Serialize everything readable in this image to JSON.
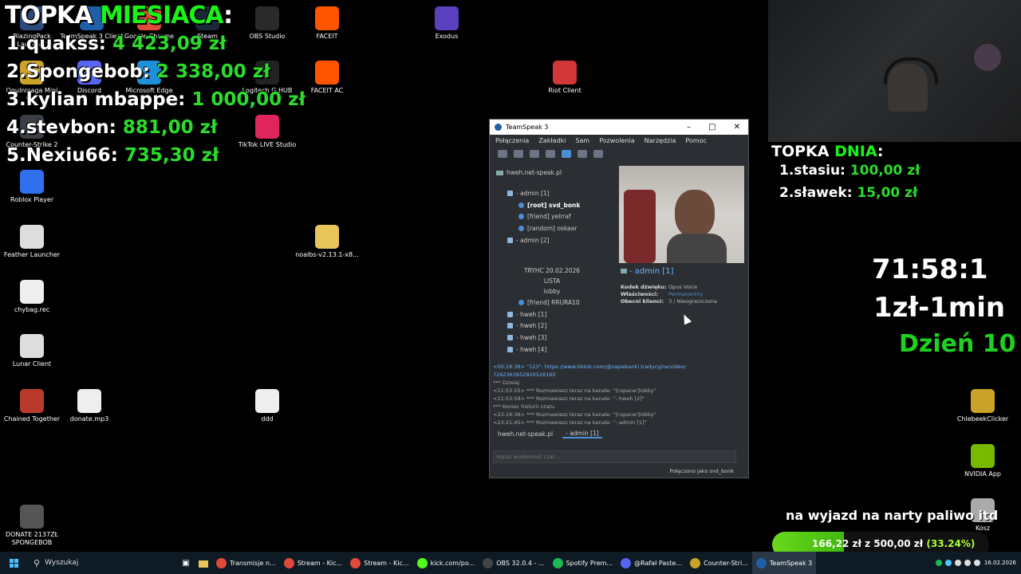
{
  "desktop_icons": [
    {
      "label": "BlazingPack Launcher",
      "color": "#2b4a7a"
    },
    {
      "label": "TeamSpeak 3 Client",
      "color": "#1f5fa8"
    },
    {
      "label": "Google Chrome",
      "color": "#e04a3a"
    },
    {
      "label": "Steam",
      "color": "#1b2838"
    },
    {
      "label": "OBS Studio",
      "color": "#2a2a2a"
    },
    {
      "label": "FACEIT",
      "color": "#ff5500"
    },
    {
      "label": "Exodus",
      "color": "#5a3fbf"
    },
    {
      "label": "Ogulnieaga Mini Gra",
      "color": "#c9a227"
    },
    {
      "label": "Discord",
      "color": "#5865f2"
    },
    {
      "label": "Microsoft Edge",
      "color": "#1e8fd9"
    },
    {
      "label": "Logitech G HUB",
      "color": "#222"
    },
    {
      "label": "FACEIT AC",
      "color": "#ff5500"
    },
    {
      "label": "Riot Client",
      "color": "#d13639"
    },
    {
      "label": "Counter-Strike 2",
      "color": "#3a3f46"
    },
    {
      "label": "TikTok LIVE Studio",
      "color": "#e0245e"
    },
    {
      "label": "Roblox Player",
      "color": "#2f6ff0"
    },
    {
      "label": "Feather Launcher",
      "color": "#ddd"
    },
    {
      "label": "noalbs-v2.13.1-x8...",
      "color": "#e8c55a"
    },
    {
      "label": "chybag.rec",
      "color": "#eee"
    },
    {
      "label": "Lunar Client",
      "color": "#ddd"
    },
    {
      "label": "Chained Together",
      "color": "#b83a2a"
    },
    {
      "label": "donate.mp3",
      "color": "#eee"
    },
    {
      "label": "ddd",
      "color": "#eee"
    },
    {
      "label": "DONATE 2137ZŁ SPONGEBOB",
      "color": "#555"
    },
    {
      "label": "ChlebeekClicker",
      "color": "#c9a227"
    },
    {
      "label": "NVIDIA App",
      "color": "#76b900"
    },
    {
      "label": "Kosz",
      "color": "#aaa"
    }
  ],
  "overlay": {
    "title_white": "TOPKA ",
    "title_green": "MIESIACA",
    "title_colon": ":",
    "ranks": [
      {
        "name": "1.quakss: ",
        "amount": "4 423,09 zł"
      },
      {
        "name": "2.Spongebob: ",
        "amount": "2 338,00 zł"
      },
      {
        "name": "3.kylian mbappe: ",
        "amount": "1 000,00 zł"
      },
      {
        "name": "4.stevbon: ",
        "amount": "881,00 zł"
      },
      {
        "name": "5.Nexiu66: ",
        "amount": "735,30 zł"
      }
    ],
    "day_title_white": "TOPKA ",
    "day_title_green": "DNIA",
    "day_title_colon": ":",
    "day_ranks": [
      {
        "name": "1.stasiu: ",
        "amount": "100,00 zł"
      },
      {
        "name": "2.sławek: ",
        "amount": "15,00 zł"
      }
    ],
    "timer": "71:58:1",
    "rate": "1zł-1min",
    "dzien": "Dzień 10",
    "goal_text": "na wyjazd na narty paliwo itd",
    "goal_current": "166,22 zł",
    "goal_z": " z ",
    "goal_total": "500,00 zł",
    "goal_pct": "(33.24%)",
    "goal_fraction": 0.3324
  },
  "teamspeak": {
    "title": "TeamSpeak 3",
    "menu": [
      "Połączenia",
      "Zakładki",
      "Sam",
      "Pozwolenia",
      "Narzędzia",
      "Pomoc"
    ],
    "server": "hweh.net-speak.pl",
    "tree": [
      {
        "label": "- admin [1]",
        "kind": "channel"
      },
      {
        "label": "[root] svd_bonk",
        "kind": "user",
        "bold": true
      },
      {
        "label": "[friend] yelrraf",
        "kind": "user"
      },
      {
        "label": "[random] oskaar",
        "kind": "user"
      },
      {
        "label": "- admin [2]",
        "kind": "channel"
      },
      {
        "label": "TRYHC 20.02.2026",
        "kind": "spacer"
      },
      {
        "label": "LISTA",
        "kind": "spacer"
      },
      {
        "label": "lobby",
        "kind": "spacer"
      },
      {
        "label": "[friend] RRURA10",
        "kind": "user"
      },
      {
        "label": "- hweh [1]",
        "kind": "channel"
      },
      {
        "label": "- hweh [2]",
        "kind": "channel"
      },
      {
        "label": "- hweh [3]",
        "kind": "channel"
      },
      {
        "label": "- hweh [4]",
        "kind": "channel"
      }
    ],
    "info": {
      "channel_name": "- admin [1]",
      "rows": [
        {
          "k": "Kodek dźwięku:",
          "v": "Opus Voice"
        },
        {
          "k": "Właściwości:",
          "v": "Permanentny"
        },
        {
          "k": "Obecni klienci:",
          "v": "3 / Nieograniczona"
        }
      ]
    },
    "chat": [
      {
        "t": "<00:18:36> \"123\": https://www.tiktok.com/@zapiekanki.tradycyjne/video/",
        "link": true
      },
      {
        "t": "7292363652920528160",
        "link": true
      },
      {
        "t": "*** Dzisiaj",
        "link": false
      },
      {
        "t": "<11:53:55> *** Rozmawiasz teraz na kanale: \"[cspacer]lobby\"",
        "link": false
      },
      {
        "t": "<11:53:58> *** Rozmawiasz teraz na kanale: \"- hweh [2]\"",
        "link": false
      },
      {
        "t": "*** Koniec historii czatu",
        "link": false
      },
      {
        "t": "<23:19:36> *** Rozmawiasz teraz na kanale: \"[cspacer]lobby\"",
        "link": false
      },
      {
        "t": "<23:21:45> *** Rozmawiasz teraz na kanale: \"- admin [1]\"",
        "link": false
      }
    ],
    "tab_server": "hweh.net-speak.pl",
    "tab_channel": "- admin [1]",
    "input_placeholder": "Wpisz wiadomość czat...",
    "status": "Połączono jako svd_bonk"
  },
  "taskbar": {
    "search": "Wyszukaj",
    "items": [
      {
        "label": "Transmisje n...",
        "color": "#e04a3a"
      },
      {
        "label": "Stream - Kic...",
        "color": "#e04a3a"
      },
      {
        "label": "Stream - Kic...",
        "color": "#e04a3a"
      },
      {
        "label": "kick.com/po...",
        "color": "#53fc18"
      },
      {
        "label": "OBS 32.0.4 - ...",
        "color": "#444"
      },
      {
        "label": "Spotify Prem...",
        "color": "#1db954"
      },
      {
        "label": "@Rafał Paste...",
        "color": "#5865f2"
      },
      {
        "label": "Counter-Stri...",
        "color": "#c9a227"
      },
      {
        "label": "TeamSpeak 3",
        "color": "#1f5fa8"
      }
    ],
    "date": "16.02.2026"
  }
}
